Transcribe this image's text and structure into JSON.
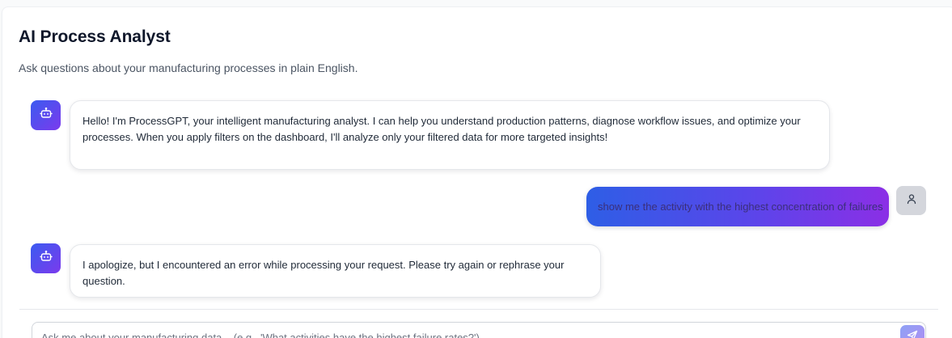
{
  "header": {
    "title": "AI Process Analyst",
    "subtitle": "Ask questions about your manufacturing processes in plain English."
  },
  "messages": [
    {
      "role": "assistant",
      "icon": "bot-icon",
      "lines": [
        "Hello! I'm ProcessGPT, your intelligent manufacturing analyst. I can help you understand production patterns, diagnose workflow issues, and optimize your",
        "processes. When you apply filters on the dashboard, I'll analyze only your filtered data for more targeted insights!"
      ]
    },
    {
      "role": "user",
      "icon": "user-icon",
      "text": "show me the activity with the highest concentration of failures"
    },
    {
      "role": "assistant",
      "icon": "bot-icon",
      "lines": [
        "I apologize, but I encountered an error while processing your request. Please try again or rephrase your question."
      ]
    }
  ],
  "composer": {
    "placeholder": "Ask me about your manufacturing data... (e.g., 'What activities have the highest failure rates?')",
    "value": "",
    "send_icon": "send-icon"
  },
  "colors": {
    "accent_start": "#2e5ee6",
    "accent_end": "#8b2fe6",
    "bot_avatar_start": "#3b5bf0",
    "bot_avatar_end": "#7b3aed",
    "user_avatar": "#d4d6dc"
  }
}
